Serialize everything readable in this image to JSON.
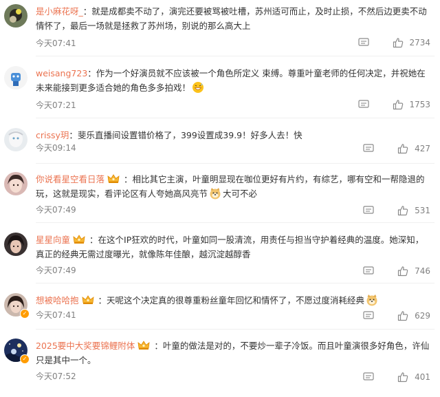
{
  "comments": [
    {
      "username": "是小麻花呀_",
      "separator": "：",
      "text": "就是成都卖不动了，演完还要被骂被吐槽，苏州适可而止，及时止损，不然后边更卖不动情怀了，最后一场就是拯救了苏州场，别说的那么高大上",
      "time": "今天07:41",
      "likes": "2734"
    },
    {
      "username": "weisang723",
      "separator": "：",
      "text": "作为一个好演员就不应该被一个角色所定义 束缚。尊重叶童老师的任何决定，并祝她在未来能接到更多适合她的角色多多拍戏！",
      "time": "今天07:21",
      "likes": "1753"
    },
    {
      "username": "crissy玥",
      "separator": "：",
      "text": "斐乐直播间设置错价格了，399设置成39.9！好多人去！快",
      "time": "今天09:14",
      "likes": "427"
    },
    {
      "username": "你说看星空看日落",
      "separator": "：",
      "text": "相比其它主演，叶童明显现在咖位更好有片约，有综艺，哪有空和一帮隐退的玩，这就是现实，看评论区有人夸她高风亮节",
      "text_after": "大可不必",
      "time": "今天07:49",
      "likes": "531"
    },
    {
      "username": "星星向童",
      "separator": "：",
      "text": "在这个IP狂欢的时代，叶童如同一股清流，用责任与担当守护着经典的温度。她深知，真正的经典无需过度曝光，就像陈年佳酿，越沉淀越醇香",
      "time": "今天07:49",
      "likes": "746"
    },
    {
      "username": "想被哈哈抱",
      "separator": "：",
      "text": "天呢这个决定真的很尊重粉丝童年回忆和情怀了，不愿过度消耗经典",
      "time": "今天07:41",
      "likes": "629"
    },
    {
      "username": "2025要中大奖要锦鲤附体",
      "separator": "：",
      "text": "叶童的做法是对的，不要炒一辈子冷饭。而且叶童演很多好角色，许仙只是其中一个。",
      "time": "今天07:52",
      "likes": "401"
    }
  ],
  "colors": {
    "username": "#eb7350",
    "text": "#333333",
    "meta": "#808080",
    "divider": "#f0f0f0"
  },
  "icons": {
    "comment": "comment-bubble-icon",
    "like": "thumbs-up-icon",
    "member_badge": "crown-badge-icon",
    "verified": "verified-badge-icon"
  }
}
